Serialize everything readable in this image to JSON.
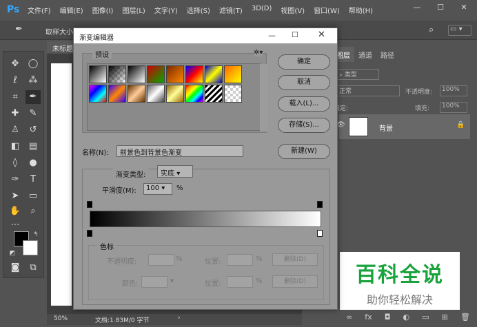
{
  "app": {
    "logo": "Ps"
  },
  "menu": [
    "文件(F)",
    "编辑(E)",
    "图像(I)",
    "图层(L)",
    "文字(Y)",
    "选择(S)",
    "滤镜(T)",
    "3D(D)",
    "视图(V)",
    "窗口(W)",
    "帮助(H)"
  ],
  "window_controls": {
    "minimize": "—",
    "maximize": "☐",
    "close": "✕"
  },
  "options": {
    "label": "取样大小"
  },
  "document": {
    "tab": "未标题",
    "zoom": "50%",
    "doc_size": "文档:1.83M/0 字节"
  },
  "layers_panel": {
    "tabs": [
      "图层",
      "通道",
      "路径"
    ],
    "filter": "类型",
    "blend_mode": "正常",
    "opacity_label": "不透明度:",
    "opacity": "100%",
    "lock_label": "锁定:",
    "fill_label": "填充:",
    "fill": "100%",
    "layer_name": "背景"
  },
  "dialog": {
    "title": "渐变编辑器",
    "presets_label": "预设",
    "buttons": {
      "ok": "确定",
      "cancel": "取消",
      "load": "载入(L)...",
      "save": "存储(S)...",
      "new": "新建(W)"
    },
    "name_label": "名称(N):",
    "name_value": "前景色到背景色渐变",
    "gradient_type_label": "渐变类型:",
    "gradient_type": "实底",
    "smoothness_label": "平滑度(M):",
    "smoothness": "100",
    "percent": "%",
    "stops_label": "色标",
    "opacity_label": "不透明度:",
    "color_label": "颜色:",
    "location_label": "位置:",
    "delete_label": "删除(D)",
    "gradient_start_color": "#000000",
    "gradient_end_color": "#ffffff"
  },
  "watermark": {
    "title": "百科全说",
    "subtitle": "助你轻松解决"
  }
}
